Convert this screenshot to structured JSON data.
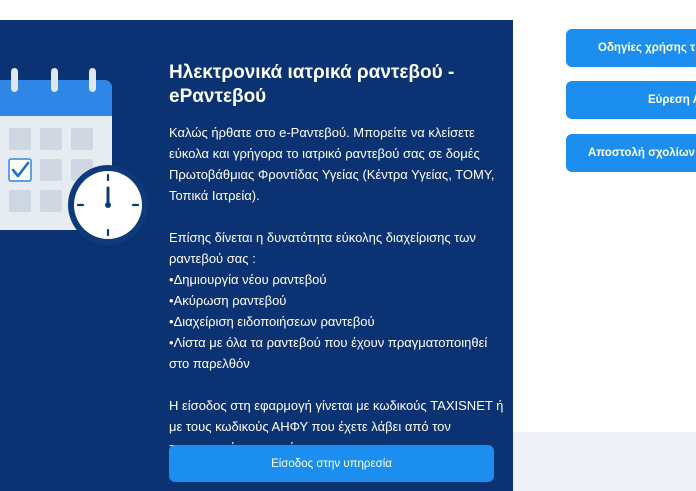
{
  "panel": {
    "title": "Ηλεκτρονικά ιατρικά ραντεβού - eΡαντεβού",
    "intro": "Καλώς ήρθατε στο e-Ραντεβού. Μπορείτε να κλείσετε εύκολα και γρήγορα το ιατρικό ραντεβού σας σε δομές Πρωτοβάθμιας Φροντίδας Υγείας (Κέντρα Υγείας, ΤΟΜΥ, Τοπικά Ιατρεία).",
    "features_intro": "Επίσης δίνεται η δυνατότητα εύκολης διαχείρισης των ραντεβού σας :",
    "features": [
      "Δημιουργία νέου ραντεβού",
      "Ακύρωση ραντεβού",
      "Διαχείριση ειδοποιήσεων ραντεβού",
      "Λίστα με όλα τα ραντεβού που έχουν πραγματοποιηθεί στο παρελθόν"
    ],
    "login_note": "Η είσοδος στη εφαρμογή γίνεται με κωδικούς TAXISNET ή με τους κωδικούς ΑΗΦΥ που έχετε λάβει από τον προσωπικό σας ιατρό.",
    "login_button": "Είσοδος στην υπηρεσία"
  },
  "side_buttons": [
    "Οδηγίες χρήσης τ",
    "Εύρεση Α",
    "Αποστολή σχολίων"
  ],
  "icons": {
    "illustration": "calendar-clock-icon",
    "check": "check-icon"
  },
  "colors": {
    "panel_bg": "#0b3272",
    "button_bg": "#1c8ef0",
    "calendar_header": "#2f86e6",
    "clock_rim": "#0e3a7a"
  }
}
